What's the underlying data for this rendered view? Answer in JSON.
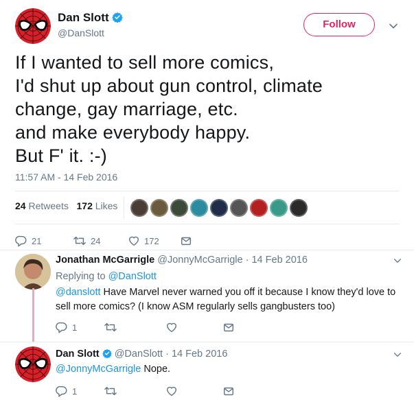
{
  "tweet": {
    "author_name": "Dan Slott",
    "author_handle": "@DanSlott",
    "follow_label": "Follow",
    "text": "If I wanted to sell more comics,\nI'd shut up about gun control, climate\nchange, gay marriage, etc.\nand make everybody happy.\nBut F' it. :-)",
    "timestamp": "11:57 AM - 14 Feb 2016",
    "retweets_count": "24",
    "retweets_label": "Retweets",
    "likes_count": "172",
    "likes_label": "Likes",
    "actions": {
      "reply": "21",
      "retweet": "24",
      "like": "172"
    }
  },
  "liker_colors": [
    "#4a3d35",
    "#6b5a3e",
    "#3c4a3a",
    "#2a8c9e",
    "#1f2d4a",
    "#555555",
    "#b32020",
    "#3a9a8a",
    "#2b2b2b"
  ],
  "replies": [
    {
      "author_name": "Jonathan McGarrigle",
      "author_handle": "@JonnyMcGarrigle",
      "date": "14 Feb 2016",
      "replying_to_label": "Replying to",
      "replying_to_handle": "@DanSlott",
      "mention": "@danslott",
      "text": " Have Marvel never warned you off it because I know they'd love to sell more comics? (I know ASM regularly sells gangbusters too)",
      "reply_count": "1"
    },
    {
      "author_name": "Dan Slott",
      "author_handle": "@DanSlott",
      "date": "14 Feb 2016",
      "mention": "@JonnyMcGarrigle",
      "text": " Nope.",
      "reply_count": "1"
    }
  ],
  "colors": {
    "accent": "#e0245e",
    "link": "#1b95e0",
    "muted": "#657786",
    "verified": "#1da1f2"
  },
  "icons": [
    "verified-badge-icon",
    "chevron-down-icon",
    "reply-icon",
    "retweet-icon",
    "heart-icon",
    "envelope-icon"
  ]
}
